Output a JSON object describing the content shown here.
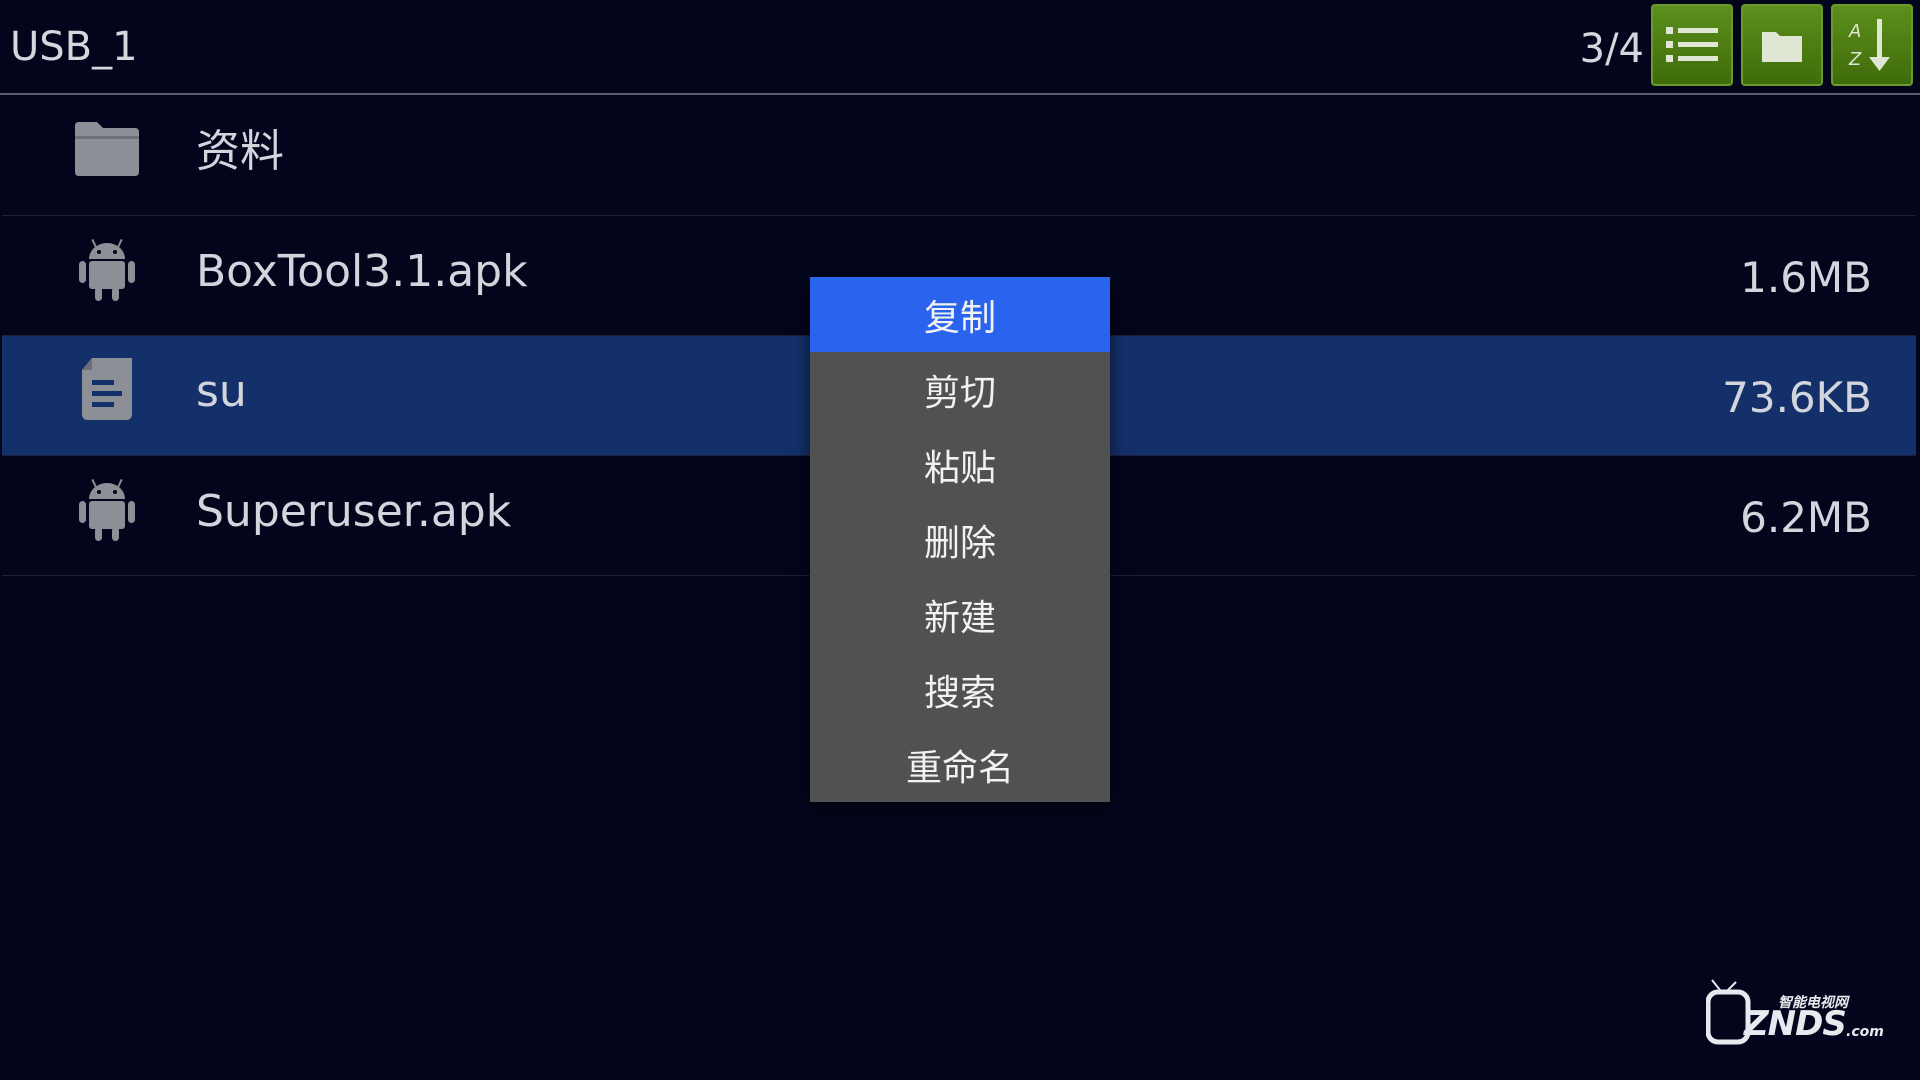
{
  "header": {
    "path": "USB_1",
    "page_indicator": "3/4",
    "buttons": [
      {
        "name": "list-view",
        "icon": "list-icon"
      },
      {
        "name": "new-folder",
        "icon": "folder-icon"
      },
      {
        "name": "sort",
        "icon": "sort-az-icon"
      }
    ]
  },
  "files": [
    {
      "name": "资料",
      "size": "",
      "icon": "folder-icon",
      "selected": false
    },
    {
      "name": "BoxTool3.1.apk",
      "size": "1.6MB",
      "icon": "android-icon",
      "selected": false
    },
    {
      "name": "su",
      "size": "73.6KB",
      "icon": "document-icon",
      "selected": true
    },
    {
      "name": "Superuser.apk",
      "size": "6.2MB",
      "icon": "android-icon",
      "selected": false
    }
  ],
  "context_menu": {
    "items": [
      "复制",
      "剪切",
      "粘贴",
      "删除",
      "新建",
      "搜索",
      "重命名"
    ],
    "active_index": 0
  },
  "watermark": {
    "text": "ZNDS",
    "sub": "智能电视网",
    "suffix": ".com"
  },
  "colors": {
    "background": "#03051d",
    "selected_row": "#14306a",
    "menu_bg": "#4f5251",
    "menu_active": "#2a63ee",
    "toolbar_button": "#4f7f14"
  }
}
